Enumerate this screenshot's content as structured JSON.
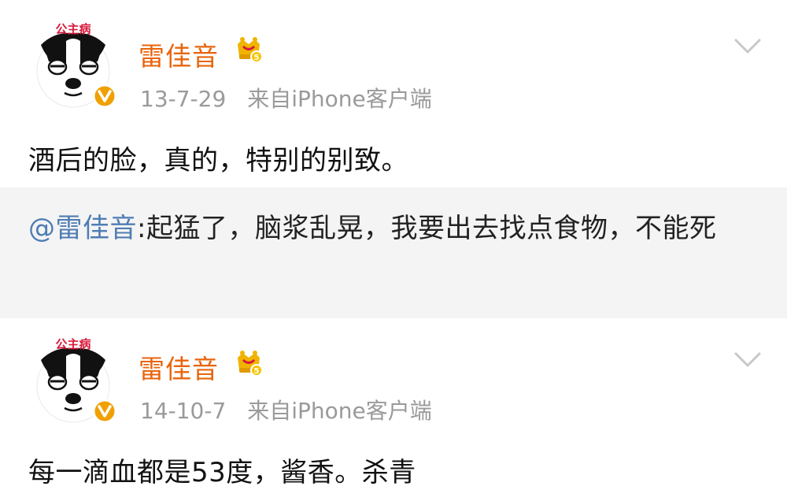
{
  "posts": [
    {
      "username": "雷佳音",
      "avatar_badge": "公主病",
      "time": "13-7-29",
      "source": "来自iPhone客户端",
      "text": "酒后的脸，真的，特别的别致。",
      "level_badge": "5"
    },
    {
      "username": "雷佳音",
      "avatar_badge": "公主病",
      "time": "14-10-7",
      "source": "来自iPhone客户端",
      "text": "每一滴血都是53度，酱香。杀青",
      "level_badge": "5"
    }
  ],
  "repost": {
    "mention": "@雷佳音",
    "text": ":起猛了，脑浆乱晃，我要出去找点食物，不能死"
  },
  "colors": {
    "username": "#e8650c",
    "meta": "#9a9a9a",
    "mention": "#4f7db3",
    "repost_bg": "#f4f4f4",
    "verified": "#f0a000",
    "avatar_badge": "#d8183a"
  },
  "icons": {
    "avatar": "bulldog-avatar-icon",
    "verified": "verified-v-icon",
    "crown": "vip-crown-icon",
    "chevron": "chevron-down-icon"
  }
}
